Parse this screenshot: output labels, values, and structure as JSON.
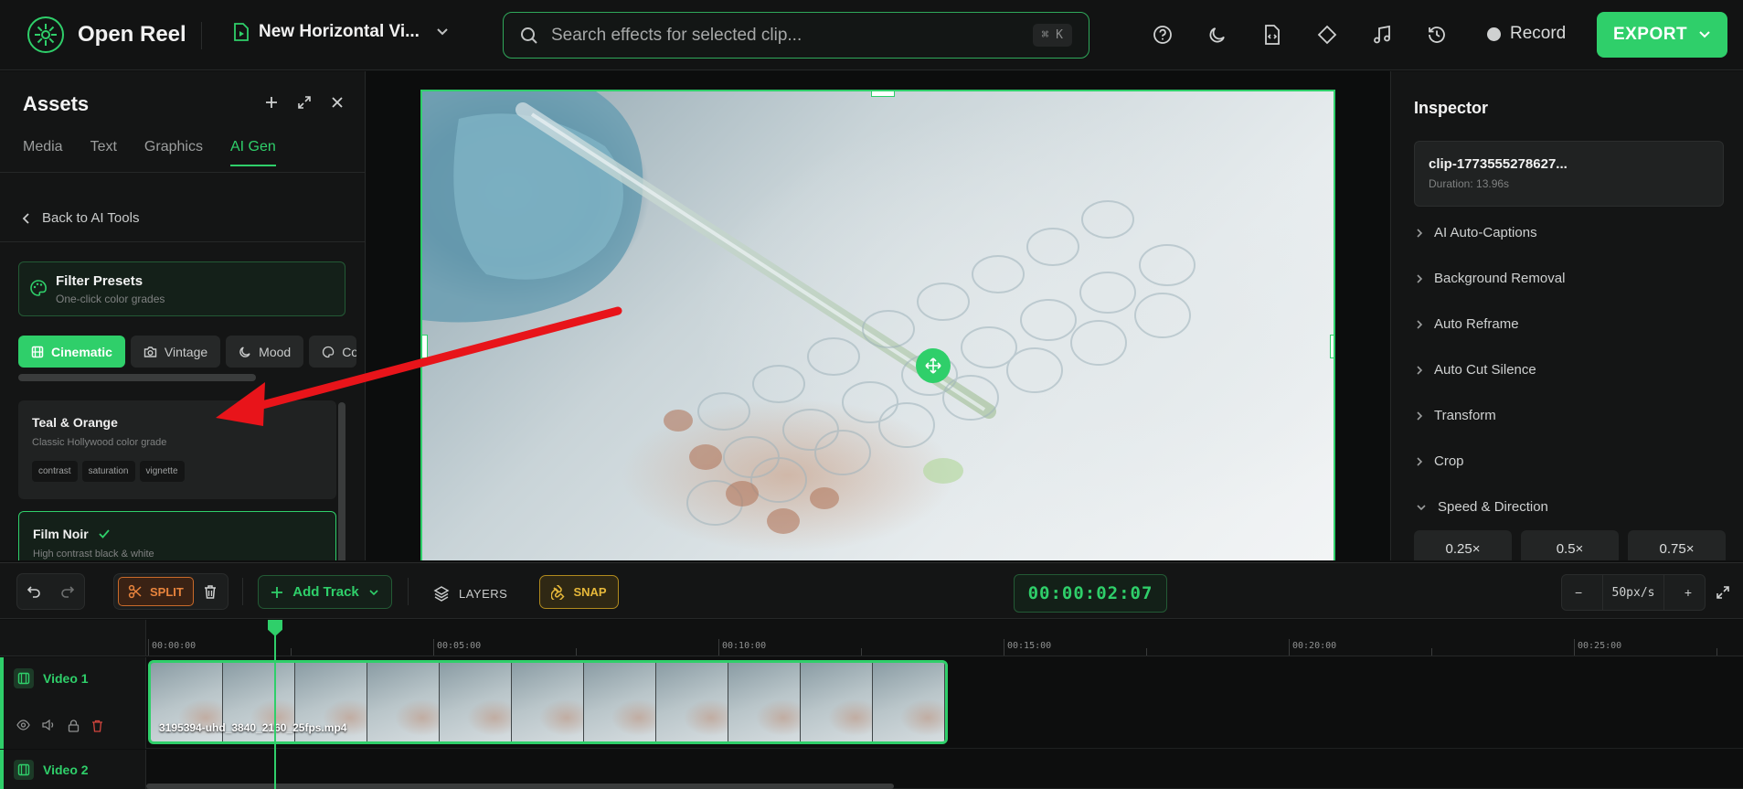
{
  "topbar": {
    "app_name": "Open Reel",
    "project_name": "New Horizontal Vi...",
    "search_placeholder": "Search effects for selected clip...",
    "search_shortcut": "⌘ K",
    "record_label": "Record",
    "export_label": "EXPORT",
    "icons": [
      "help-icon",
      "moon-icon",
      "file-code-icon",
      "diamond-icon",
      "music-icon",
      "history-icon"
    ]
  },
  "assets": {
    "title": "Assets",
    "tabs": [
      "Media",
      "Text",
      "Graphics",
      "AI Gen"
    ],
    "active_tab": "AI Gen",
    "back_label": "Back to AI Tools",
    "filter_presets": {
      "title": "Filter Presets",
      "subtitle": "One-click color grades"
    },
    "categories": [
      "Cinematic",
      "Vintage",
      "Mood",
      "Co"
    ],
    "active_category": "Cinematic",
    "presets": [
      {
        "title": "Teal & Orange",
        "subtitle": "Classic Hollywood color grade",
        "tags": [
          "contrast",
          "saturation",
          "vignette"
        ]
      },
      {
        "title": "Film Noir",
        "subtitle": "High contrast black & white",
        "selected": true
      }
    ]
  },
  "inspector": {
    "title": "Inspector",
    "clip_name": "clip-1773555278627...",
    "clip_duration": "Duration: 13.96s",
    "sections": [
      "AI Auto-Captions",
      "Background Removal",
      "Auto Reframe",
      "Auto Cut Silence",
      "Transform",
      "Crop",
      "Speed & Direction"
    ],
    "expanded_section": "Speed & Direction",
    "speed_options": [
      "0.25×",
      "0.5×",
      "0.75×"
    ]
  },
  "timeline_toolbar": {
    "split_label": "SPLIT",
    "add_track_label": "Add Track",
    "layers_label": "LAYERS",
    "snap_label": "SNAP",
    "timecode": "00:00:02:07",
    "zoom_value": "50px/s",
    "zoom_minus": "−",
    "zoom_plus": "+"
  },
  "timeline": {
    "ruler_labels": [
      "00:00:00",
      "00:05:00",
      "00:10:00",
      "00:15:00",
      "00:20:00",
      "00:25:00"
    ],
    "tracks": [
      {
        "name": "Video 1"
      },
      {
        "name": "Video 2"
      }
    ],
    "clip_filename": "3195394-uhd_3840_2160_25fps.mp4"
  },
  "colors": {
    "accent": "#2fcf6a",
    "split": "#e8843d",
    "snap": "#e6b83a",
    "annotation_arrow": "#e8141a"
  }
}
